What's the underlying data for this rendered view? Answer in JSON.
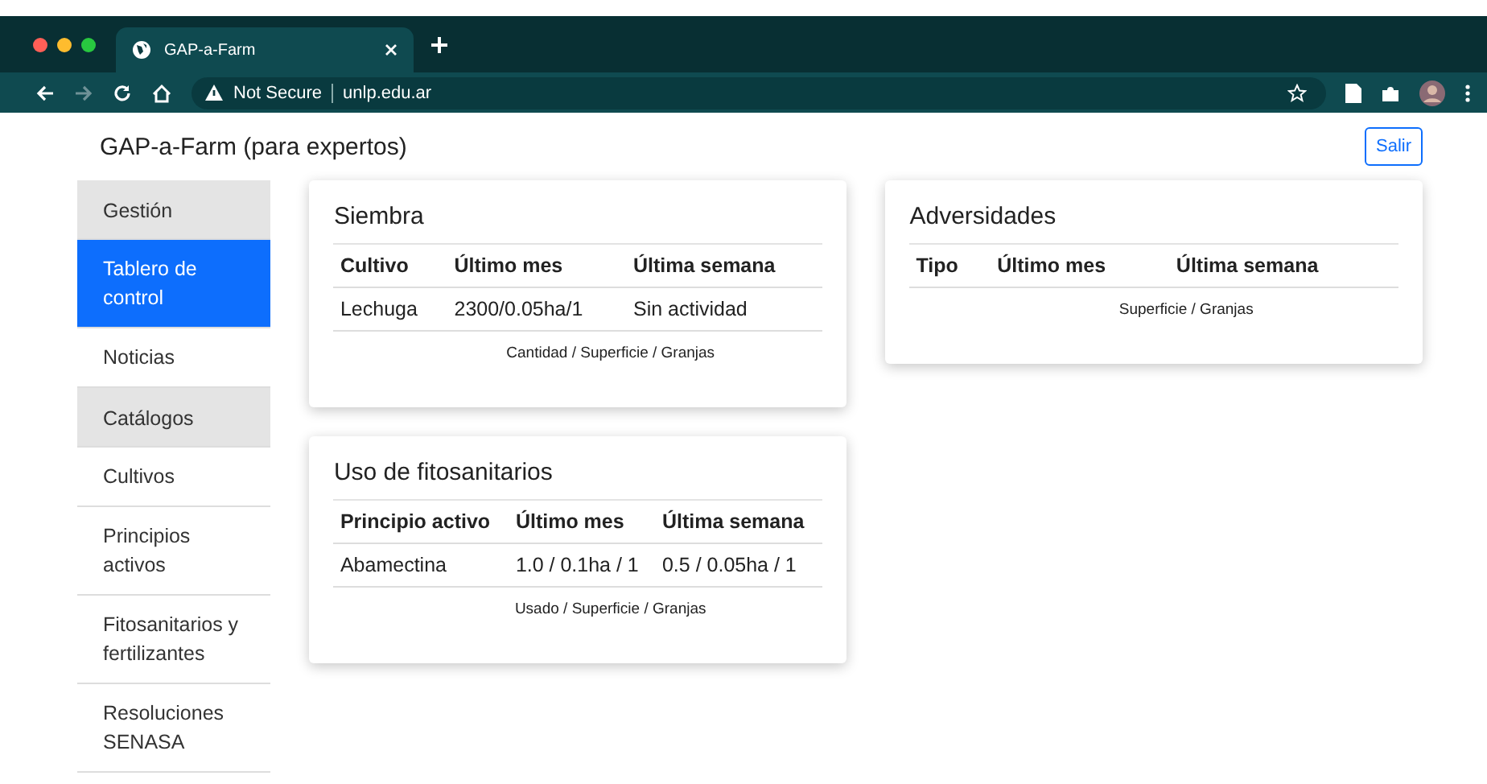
{
  "browser": {
    "tab_title": "GAP-a-Farm",
    "security": "Not Secure",
    "url": "unlp.edu.ar"
  },
  "header": {
    "title": "GAP-a-Farm (para expertos)",
    "logout": "Salir"
  },
  "sidebar": {
    "items": [
      {
        "kind": "header",
        "label": "Gestión",
        "selected": false
      },
      {
        "kind": "link",
        "label": "Tablero de control",
        "selected": true
      },
      {
        "kind": "link",
        "label": "Noticias",
        "selected": false
      },
      {
        "kind": "header",
        "label": "Catálogos",
        "selected": false
      },
      {
        "kind": "link",
        "label": "Cultivos",
        "selected": false
      },
      {
        "kind": "link",
        "label": "Principios activos",
        "selected": false
      },
      {
        "kind": "link",
        "label": "Fitosanitarios y fertilizantes",
        "selected": false
      },
      {
        "kind": "link",
        "label": "Resoluciones SENASA",
        "selected": false
      }
    ]
  },
  "cards": [
    {
      "title": "Siembra",
      "columns": [
        "Cultivo",
        "Último mes",
        "Última semana"
      ],
      "rows": [
        [
          "Lechuga",
          "2300/0.05ha/1",
          "Sin actividad"
        ]
      ],
      "caption": "Cantidad / Superficie / Granjas"
    },
    {
      "title": "Uso de fitosanitarios",
      "columns": [
        "Principio activo",
        "Último mes",
        "Última semana"
      ],
      "rows": [
        [
          "Abamectina",
          "1.0 / 0.1ha / 1",
          "0.5 / 0.05ha / 1"
        ]
      ],
      "caption": "Usado / Superficie / Granjas"
    },
    {
      "title": "Adversidades",
      "columns": [
        "Tipo",
        "Último mes",
        "Última semana"
      ],
      "caption": "Superficie / Granjas"
    }
  ]
}
